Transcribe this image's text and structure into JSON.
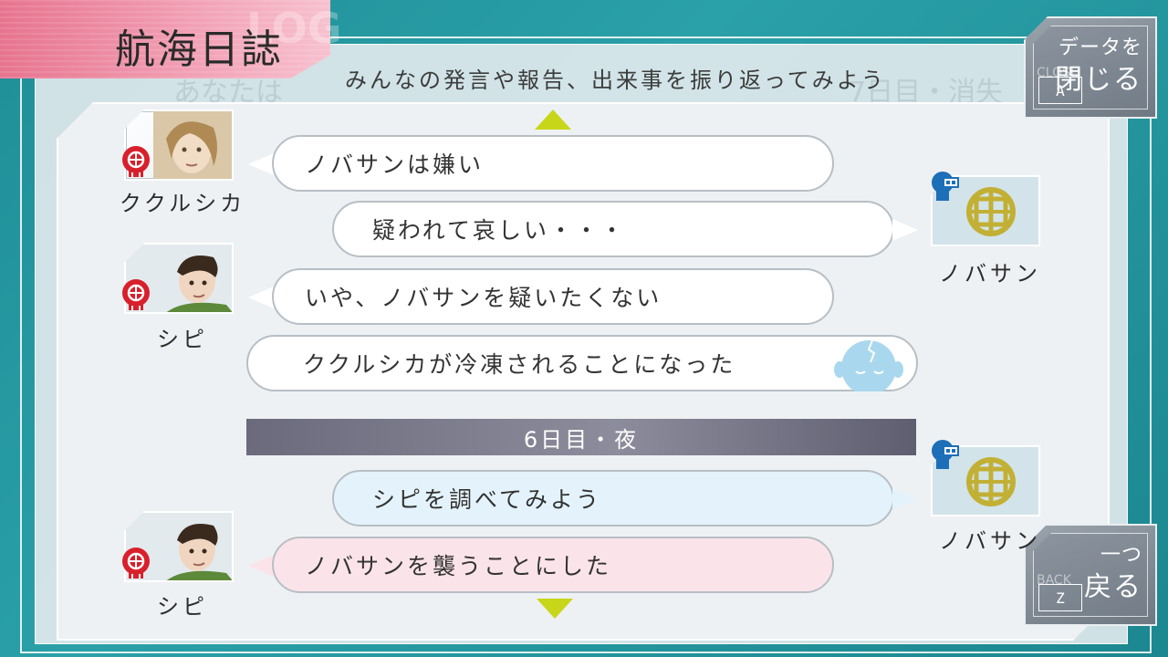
{
  "title": "航海日誌",
  "title_ghost": "LOG",
  "subtitle": "みんなの発言や報告、出来事を振り返ってみよう",
  "ghost_texts": [
    "あなたは",
    "7日目・消失"
  ],
  "top_right_button": {
    "small_label": "データを",
    "big_label": "閉じる",
    "ghost_label": "CLOSE",
    "key": "A"
  },
  "bottom_right_button": {
    "small_label": "一つ",
    "big_label": "戻る",
    "ghost_label": "BACK",
    "key": "Z"
  },
  "entries": [
    {
      "speaker": "ククルシカ",
      "text": "ノバサンは嫌い",
      "bubble": "white",
      "side": "left"
    },
    {
      "speaker": "ノバサン",
      "text": "疑われて哀しい・・・",
      "bubble": "white",
      "side": "right"
    },
    {
      "speaker": "シピ",
      "text": "いや、ノバサンを疑いたくない",
      "bubble": "white",
      "side": "left"
    },
    {
      "speaker": "",
      "text": "ククルシカが冷凍されることになった",
      "bubble": "white",
      "side": "system"
    },
    {
      "speaker": "",
      "text": "6日目・夜",
      "bubble": "divider",
      "side": "divider"
    },
    {
      "speaker": "ノバサン",
      "text": "シピを調べてみよう",
      "bubble": "blue",
      "side": "right"
    },
    {
      "speaker": "シピ",
      "text": "ノバサンを襲うことにした",
      "bubble": "pink",
      "side": "left"
    }
  ],
  "colors": {
    "background": "#2aa0a8",
    "title_tab": "#f2a2b6",
    "arrow": "#c8d61a",
    "badge_red": "#d8202c",
    "engineer_blue": "#1d6fb8",
    "divider": "#7a798a"
  }
}
